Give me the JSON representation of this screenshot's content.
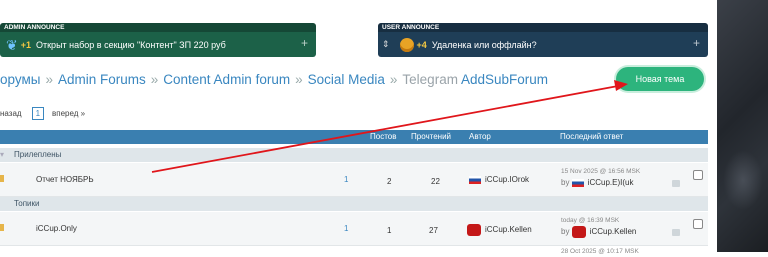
{
  "announcements": {
    "admin": {
      "header": "ADMIN ANNOUNCE",
      "count": "+1",
      "text": "Открыт набор в секцию \"Контент\" ЗП 220 руб",
      "plus": "+"
    },
    "user": {
      "header": "USER ANNOUNCE",
      "count": "+4",
      "text": "Удаленка или оффлайн?",
      "plus": "+"
    }
  },
  "breadcrumb": {
    "items": [
      "орумы",
      "Admin Forums",
      "Content Admin forum",
      "Social Media",
      "Telegram",
      "AddSubForum"
    ],
    "separator": "»"
  },
  "new_thread_label": "Новая тема",
  "pager": {
    "prev": "назад",
    "current": "1",
    "next": "вперед »"
  },
  "table": {
    "headers": {
      "posts": "Постов",
      "views": "Прочтений",
      "author": "Автор",
      "last": "Последний ответ"
    },
    "sections": {
      "pinned": "Прилеплены",
      "topics": "Топики"
    },
    "rows": [
      {
        "title": "Отчет НОЯБРЬ",
        "pages": "1",
        "posts": "2",
        "views": "22",
        "author": "iCCup.IOrok",
        "last_date": "15 Nov 2025 @ 16:56 MSK",
        "last_by": "by",
        "last_user": "iCCup.E)I(uk"
      },
      {
        "title": "iCCup.Only",
        "pages": "1",
        "posts": "1",
        "views": "27",
        "author": "iCCup.Kellen",
        "last_date": "today @ 16:39 MSK",
        "last_by": "by",
        "last_user": "iCCup.Kellen"
      }
    ],
    "next_row_date": "28 Oct 2025 @ 10:17 MSK"
  },
  "colors": {
    "admin_bg": "#1c6148",
    "user_bg": "#1f3e57",
    "link": "#3a87c0",
    "new_thread": "#2db47d",
    "table_header": "#3a7fb0",
    "arrow": "#e0161b"
  }
}
